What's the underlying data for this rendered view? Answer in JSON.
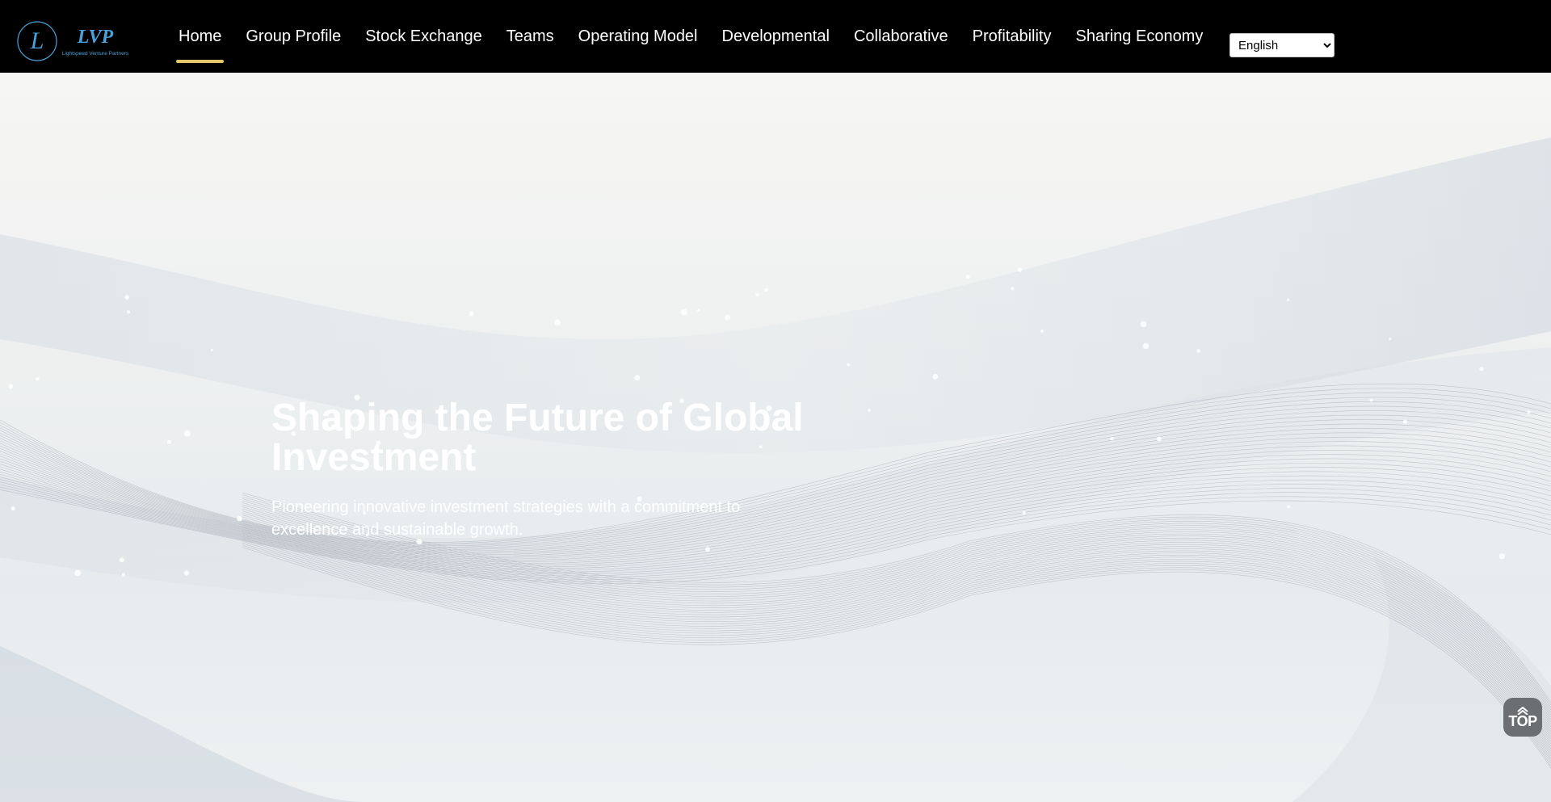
{
  "brand": {
    "logo_mark": "L",
    "logo_text": "LVP",
    "logo_tagline": "Lightspeed Venture Partners",
    "accent_color": "#e5c76b",
    "logo_color": "#4aa3d8"
  },
  "nav": {
    "items": [
      {
        "label": "Home",
        "active": true
      },
      {
        "label": "Group Profile"
      },
      {
        "label": "Stock Exchange"
      },
      {
        "label": "Teams"
      },
      {
        "label": "Operating Model"
      },
      {
        "label": "Developmental"
      },
      {
        "label": "Collaborative"
      },
      {
        "label": "Profitability"
      },
      {
        "label": "Sharing Economy"
      }
    ],
    "language": {
      "selected": "English"
    }
  },
  "hero": {
    "title": "Shaping the Future of Global Investment",
    "subtitle": "Pioneering innovative investment strategies with a commitment to excellence and sustainable growth."
  },
  "back_to_top": {
    "label": "TOP",
    "icon": "double-chevron-up-icon"
  }
}
